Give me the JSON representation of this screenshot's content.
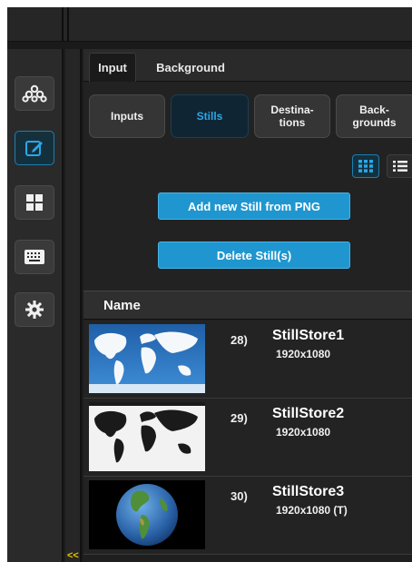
{
  "tabs": {
    "input": "Input",
    "background": "Background",
    "active": "Input"
  },
  "segments": [
    {
      "label": "Inputs",
      "active": false
    },
    {
      "label": "Stills",
      "active": true
    },
    {
      "label": "Destina-\ntions",
      "active": false
    },
    {
      "label": "Back-\ngrounds",
      "active": false
    }
  ],
  "view_modes": [
    {
      "icon": "grid-view-icon",
      "active": true
    },
    {
      "icon": "list-view-icon",
      "active": false
    }
  ],
  "actions": {
    "add_still": "Add new Still from PNG",
    "delete_still": "Delete Still(s)"
  },
  "table": {
    "column_name": "Name"
  },
  "stills": [
    {
      "index": "28)",
      "name": "StillStore1",
      "resolution": "1920x1080",
      "thumbnail": "world-map-blue"
    },
    {
      "index": "29)",
      "name": "StillStore2",
      "resolution": "1920x1080",
      "thumbnail": "world-map-bw"
    },
    {
      "index": "30)",
      "name": "StillStore3",
      "resolution": "1920x1080 (T)",
      "thumbnail": "globe"
    }
  ],
  "sidebar": {
    "items": [
      {
        "icon": "sources-icon",
        "active": false
      },
      {
        "icon": "edit-icon",
        "active": true
      },
      {
        "icon": "layout-grid-icon",
        "active": false
      },
      {
        "icon": "keyboard-icon",
        "active": false
      },
      {
        "icon": "settings-gear-icon",
        "active": false
      }
    ]
  },
  "collapse_label": "<<",
  "colors": {
    "accent": "#1f96cf",
    "active_text": "#2aa7e6",
    "collapse": "#e8c400"
  }
}
